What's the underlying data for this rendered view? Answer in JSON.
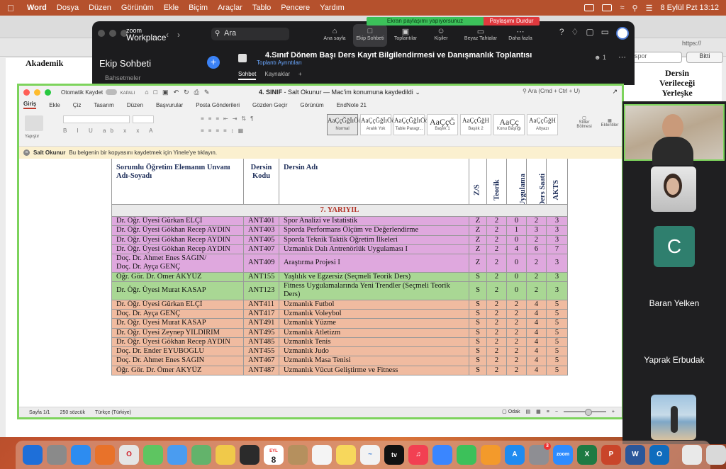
{
  "menubar": {
    "app": "Word",
    "items": [
      "Dosya",
      "Düzen",
      "Görünüm",
      "Ekle",
      "Biçim",
      "Araçlar",
      "Tablo",
      "Pencere",
      "Yardım"
    ],
    "datetime": "8 Eylül Pzt  13:12"
  },
  "share_banner": {
    "message": "Ekran paylaşımı yapıyorsunuz",
    "stop": "Paylaşımı Durdur"
  },
  "background_doc": {
    "left_header": "Akademik",
    "right_header": [
      "Dersin",
      "Verileceği",
      "Yerleşke"
    ],
    "search_value": "spor",
    "done_button": "Bitti",
    "url": "https://"
  },
  "zoom": {
    "brand_small": "zoom",
    "brand": "Workplace",
    "search_placeholder": "Ara",
    "nav": [
      {
        "label": "Ana sayfa",
        "icon": "home-icon"
      },
      {
        "label": "Ekip Sohbeti",
        "icon": "chat-icon",
        "active": true
      },
      {
        "label": "Toplantılar",
        "icon": "video-icon"
      },
      {
        "label": "Kişiler",
        "icon": "contacts-icon"
      },
      {
        "label": "Beyaz Tahtalar",
        "icon": "whiteboard-icon"
      },
      {
        "label": "Daha fazla",
        "icon": "more-icon"
      }
    ],
    "chat_title": "Ekip Sohbeti",
    "meeting_title": "4.Sınıf  Dönem Başı Ders Kayıt Bilgilendirmesi ve Danışmanlık Toplantısı",
    "meeting_details": "Toplantı Ayrıntıları",
    "participant_count": "1",
    "tabs": [
      "Sohbet",
      "Kaynaklar"
    ],
    "mention": "Bahsetmeler"
  },
  "word": {
    "autosave": "Otomatik Kaydet",
    "autosave_state": "KAPALI",
    "doc_name": "4. SINIF",
    "doc_status": " - Salt Okunur — Mac'im konumuna kaydedildi",
    "search_placeholder": "Ara (Cmd + Ctrl + U)",
    "tabs": [
      "Giriş",
      "Ekle",
      "Çiz",
      "Tasarım",
      "Düzen",
      "Başvurular",
      "Posta Gönderileri",
      "Gözden Geçir",
      "Görünüm",
      "EndNote 21"
    ],
    "paste": "Yapıştır",
    "styles": [
      {
        "preview": "AaÇçĞğİıÖö",
        "name": "Normal"
      },
      {
        "preview": "AaÇçĞğİıÖö",
        "name": "Aralık Yok"
      },
      {
        "preview": "AaÇçĞğİıÖö",
        "name": "Table Paragr..."
      },
      {
        "preview": "AaÇçĞ",
        "name": "Başlık 1"
      },
      {
        "preview": "AaÇçĞğH",
        "name": "Başlık 2"
      },
      {
        "preview": "AaÇç",
        "name": "Konu Başlığı"
      },
      {
        "preview": "AaÇçĞğH",
        "name": "Altyazı"
      }
    ],
    "styles_pane": "Stiller Bölmesi",
    "addins": "Eklentiler",
    "info_label": "Salt Okunur",
    "info_text": "Bu belgenin bir kopyasını kaydetmek için Yinele'ye tıklayın.",
    "status": {
      "page": "Sayfa 1/1",
      "words": "250 sözcük",
      "lang": "Türkçe (Türkiye)",
      "focus": "Odak"
    }
  },
  "table": {
    "headers": {
      "instructor": "Sorumlu Öğretim Elemanın Unvanı Adı-Soyadı",
      "code": "Dersin Kodu",
      "name": "Dersin Adı",
      "zs": "Z/S",
      "theory": "Teorik",
      "practice": "Uygulama",
      "hours": "Ders Saati",
      "ects": "AKTS"
    },
    "semester": "7. YARIYIL",
    "rows": [
      {
        "i": "Dr. Öğr. Üyesi Gürkan ELÇİ",
        "c": "ANT401",
        "n": "Spor Analizi ve İstatistik",
        "zs": "Z",
        "t": "2",
        "u": "0",
        "s": "2",
        "a": "3",
        "g": "pink"
      },
      {
        "i": "Dr. Öğr. Üyesi Gökhan Recep AYDIN",
        "c": "ANT403",
        "n": "Sporda Performans Ölçüm ve Değerlendirme",
        "zs": "Z",
        "t": "2",
        "u": "1",
        "s": "3",
        "a": "3",
        "g": "pink"
      },
      {
        "i": "Dr. Öğr. Üyesi Gökhan Recep AYDIN",
        "c": "ANT405",
        "n": "Sporda Teknik Taktik Öğretim İlkeleri",
        "zs": "Z",
        "t": "2",
        "u": "0",
        "s": "2",
        "a": "3",
        "g": "pink"
      },
      {
        "i": "Dr. Öğr. Üyesi Gökhan Recep AYDIN",
        "c": "ANT407",
        "n": "Uzmanlık Dalı Antrenörlük Uygulaması I",
        "zs": "Z",
        "t": "2",
        "u": "4",
        "s": "6",
        "a": "7",
        "g": "pink"
      },
      {
        "i": "Doç. Dr. Ahmet Enes SAĞIN/\nDoç. Dr. Ayça GENÇ",
        "c": "ANT409",
        "n": "Araştırma Projesi I",
        "zs": "Z",
        "t": "2",
        "u": "0",
        "s": "2",
        "a": "3",
        "g": "pink"
      },
      {
        "i": "Öğr. Gör. Dr. Ömer AKYÜZ",
        "c": "ANT155",
        "n": "Yaşlılık ve Egzersiz (Seçmeli Teorik Ders)",
        "zs": "S",
        "t": "2",
        "u": "0",
        "s": "2",
        "a": "3",
        "g": "green"
      },
      {
        "i": "Dr. Öğr. Üyesi Murat KASAP",
        "c": "ANT123",
        "n": "Fitness Uygulamalarında Yeni Trendler (Seçmeli Teorik Ders)",
        "zs": "S",
        "t": "2",
        "u": "0",
        "s": "2",
        "a": "3",
        "g": "green"
      },
      {
        "i": "Dr. Öğr. Üyesi Gürkan ELÇİ",
        "c": "ANT411",
        "n": "Uzmanlık Futbol",
        "zs": "S",
        "t": "2",
        "u": "2",
        "s": "4",
        "a": "5",
        "g": "peach"
      },
      {
        "i": "Doç. Dr. Ayça GENÇ",
        "c": "ANT417",
        "n": "Uzmanlık Voleybol",
        "zs": "S",
        "t": "2",
        "u": "2",
        "s": "4",
        "a": "5",
        "g": "peach"
      },
      {
        "i": "Dr. Öğr. Üyesi Murat KASAP",
        "c": "ANT491",
        "n": "Uzmanlık Yüzme",
        "zs": "S",
        "t": "2",
        "u": "2",
        "s": "4",
        "a": "5",
        "g": "peach"
      },
      {
        "i": "Dr. Öğr. Üyesi Zeynep YILDIRIM",
        "c": "ANT495",
        "n": "Uzmanlık Atletizm",
        "zs": "S",
        "t": "2",
        "u": "2",
        "s": "4",
        "a": "5",
        "g": "peach"
      },
      {
        "i": "Dr. Öğr. Üyesi Gökhan Recep AYDIN",
        "c": "ANT485",
        "n": "Uzmanlık Tenis",
        "zs": "S",
        "t": "2",
        "u": "2",
        "s": "4",
        "a": "5",
        "g": "peach"
      },
      {
        "i": "Doç. Dr. Ender EYUBOĞLU",
        "c": "ANT455",
        "n": "Uzmanlık Judo",
        "zs": "S",
        "t": "2",
        "u": "2",
        "s": "4",
        "a": "5",
        "g": "peach"
      },
      {
        "i": "Doç. Dr. Ahmet Enes SAĞIN",
        "c": "ANT467",
        "n": "Uzmanlık Masa Tenisi",
        "zs": "S",
        "t": "2",
        "u": "2",
        "s": "4",
        "a": "5",
        "g": "peach"
      },
      {
        "i": "Öğr. Gör. Dr. Ömer AKYÜZ",
        "c": "ANT487",
        "n": "Uzmanlık Vücut Geliştirme ve Fitness",
        "zs": "S",
        "t": "2",
        "u": "2",
        "s": "4",
        "a": "5",
        "g": "peach"
      }
    ]
  },
  "participants": {
    "c_initial": "C",
    "names": [
      "Baran Yelken",
      "Yaprak Erbudak"
    ]
  },
  "dock": {
    "calendar_month": "EYL",
    "calendar_day": "8",
    "tv_label": "tv",
    "settings_badge": "3",
    "zoom_label": "zoom"
  },
  "colors": {
    "pink": "#dfa8de",
    "green": "#a9d794",
    "peach": "#f0bba0",
    "semester_text": "#b23226",
    "share_green": "#3cc15a",
    "share_red": "#e0393e"
  }
}
